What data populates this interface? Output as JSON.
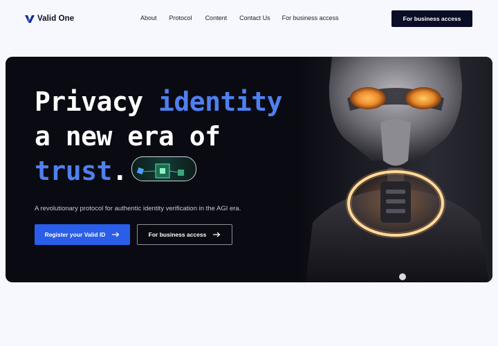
{
  "brand": {
    "name": "Valid One",
    "accent": "#2a5ee8"
  },
  "nav": {
    "items": [
      "About",
      "Protocol",
      "Content",
      "Contact Us",
      "For business access"
    ]
  },
  "header": {
    "cta_label": "For business access"
  },
  "hero": {
    "headline": {
      "l1_white": "Privacy ",
      "l1_blue": "identity",
      "l2": "a new era of",
      "l3_blue": "trust",
      "l3_dot": "."
    },
    "subtitle": "A revolutionary protocol for authentic identity verification in the AGI era.",
    "primary_cta": "Register your Valid ID",
    "secondary_cta": "For business access",
    "colors": {
      "background": "#0a0b12",
      "highlight": "#4f80f0"
    },
    "icons": [
      "arrow-right-icon",
      "arrow-right-icon"
    ]
  }
}
